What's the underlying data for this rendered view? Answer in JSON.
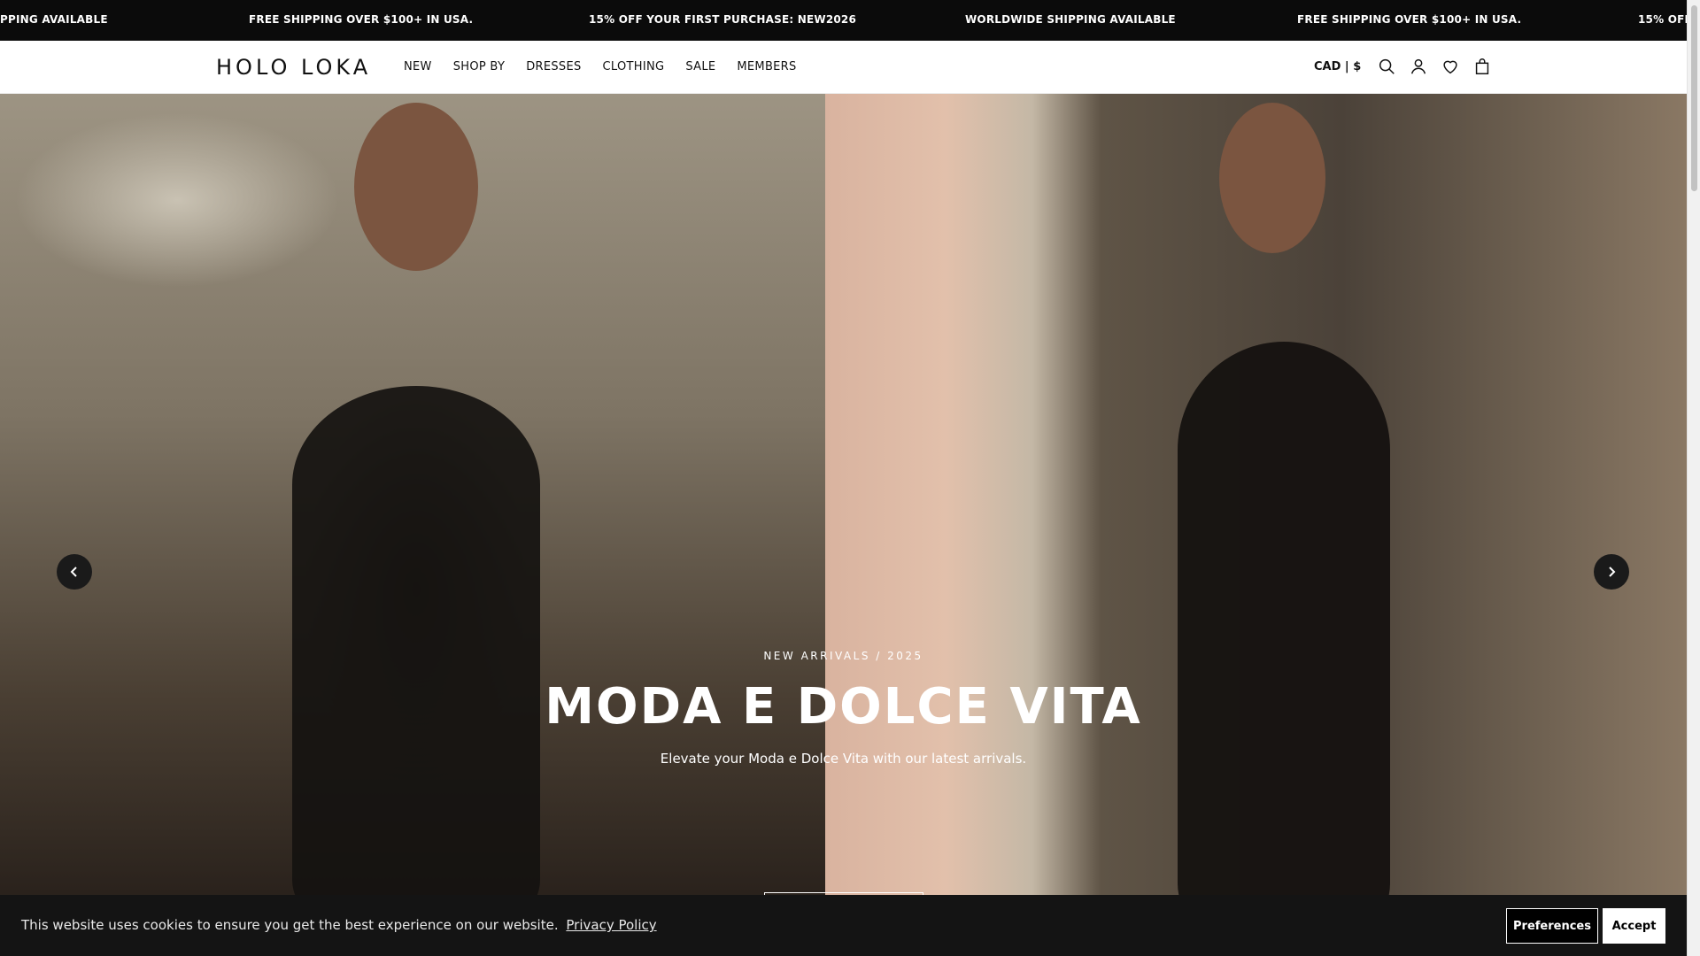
{
  "announcement": {
    "items": [
      "PPING AVAILABLE",
      "FREE SHIPPING OVER $100+ IN USA.",
      "15% OFF YOUR FIRST PURCHASE: NEW2026",
      "WORLDWIDE SHIPPING AVAILABLE",
      "FREE SHIPPING OVER $100+ IN USA.",
      "15% OFF Y"
    ]
  },
  "header": {
    "logo": "HOLO LOKA",
    "nav": [
      "NEW",
      "SHOP BY",
      "DRESSES",
      "CLOTHING",
      "SALE",
      "MEMBERS"
    ],
    "currency": "CAD | $",
    "icons": [
      "search-icon",
      "account-icon",
      "wishlist-heart-icon",
      "shopping-bag-icon"
    ]
  },
  "hero": {
    "eyebrow": "NEW ARRIVALS / 2025",
    "headline": "MODA E DOLCE VITA",
    "subtext": "Elevate your Moda e Dolce Vita with our latest arrivals.",
    "prev_icon": "chevron-left-icon",
    "next_icon": "chevron-right-icon"
  },
  "cookie": {
    "text": "This website uses cookies to ensure you get the best experience on our website.",
    "link": "Privacy Policy",
    "preferences": "Preferences",
    "accept": "Accept"
  },
  "colors": {
    "bar_bg": "#0b0b0b",
    "text_dark": "#111111",
    "white": "#ffffff"
  }
}
